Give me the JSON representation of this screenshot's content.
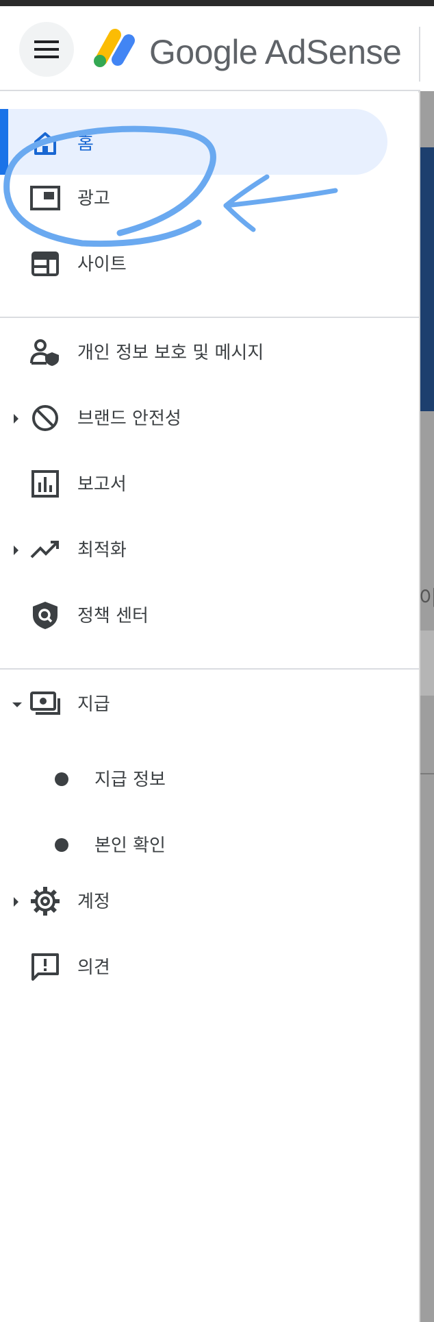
{
  "header": {
    "brand_google": "Google",
    "brand_product": "AdSense",
    "logo_colors": {
      "yellow": "#fbbc04",
      "blue": "#4285f4",
      "green": "#34a853"
    }
  },
  "nav": {
    "home": "홈",
    "ads": "광고",
    "sites": "사이트",
    "privacy": "개인 정보 보호 및 메시지",
    "brand_safety": "브랜드 안전성",
    "reports": "보고서",
    "optimization": "최적화",
    "policy_center": "정책 센터",
    "payments": "지급",
    "payments_info": "지급 정보",
    "identity_verification": "본인 확인",
    "account": "계정",
    "feedback": "의견"
  },
  "background": {
    "partial_text": "이"
  },
  "colors": {
    "accent": "#1a73e8",
    "active_bg": "#e8f0fe",
    "annotation": "#6aa9f0"
  }
}
